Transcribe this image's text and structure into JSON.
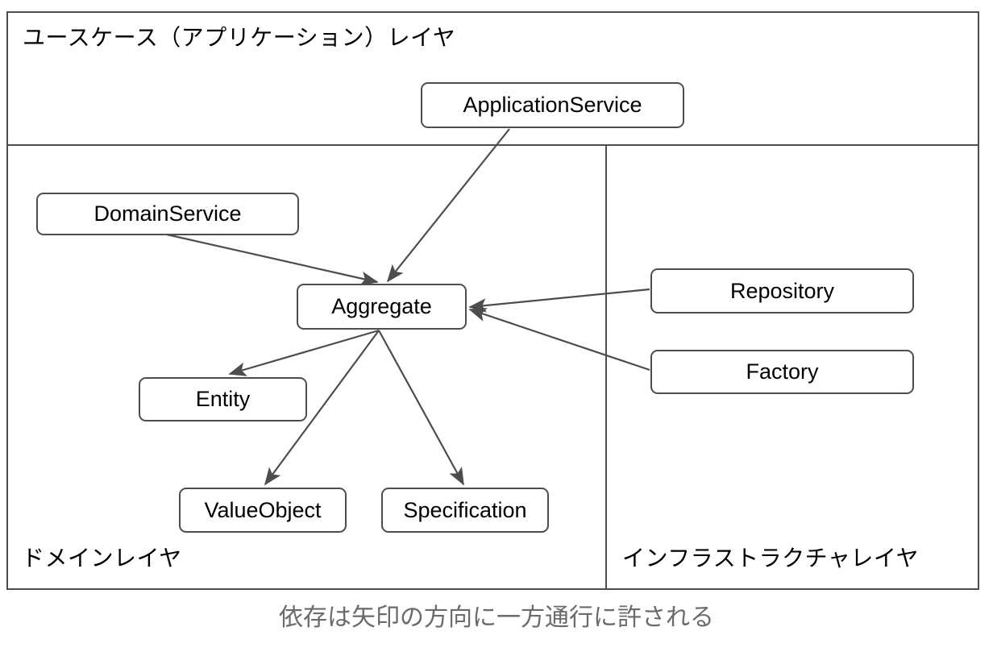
{
  "diagram": {
    "title_usecase_layer": "ユースケース（アプリケーション）レイヤ",
    "title_domain_layer": "ドメインレイヤ",
    "title_infrastructure_layer": "インフラストラクチャレイヤ",
    "caption": "依存は矢印の方向に一方通行に許される",
    "colors": {
      "stroke": "#4d4d4d",
      "node_fill": "#ffffff",
      "text": "#000000",
      "caption_text": "#6b6b6b",
      "background": "#ffffff"
    },
    "nodes": [
      {
        "id": "applicationservice",
        "label": "ApplicationService",
        "layer": "usecase"
      },
      {
        "id": "domainservice",
        "label": "DomainService",
        "layer": "domain"
      },
      {
        "id": "aggregate",
        "label": "Aggregate",
        "layer": "domain"
      },
      {
        "id": "entity",
        "label": "Entity",
        "layer": "domain"
      },
      {
        "id": "valueobject",
        "label": "ValueObject",
        "layer": "domain"
      },
      {
        "id": "specification",
        "label": "Specification",
        "layer": "domain"
      },
      {
        "id": "repository",
        "label": "Repository",
        "layer": "infrastructure"
      },
      {
        "id": "factory",
        "label": "Factory",
        "layer": "infrastructure"
      }
    ],
    "edges": [
      {
        "id": "applicationservice-to-aggregate",
        "from": "applicationservice",
        "to": "aggregate"
      },
      {
        "id": "domainservice-to-aggregate",
        "from": "domainservice",
        "to": "aggregate"
      },
      {
        "id": "repository-to-aggregate",
        "from": "repository",
        "to": "aggregate"
      },
      {
        "id": "factory-to-aggregate",
        "from": "factory",
        "to": "aggregate"
      },
      {
        "id": "aggregate-to-entity",
        "from": "aggregate",
        "to": "entity"
      },
      {
        "id": "aggregate-to-valueobject",
        "from": "aggregate",
        "to": "valueobject"
      },
      {
        "id": "aggregate-to-specification",
        "from": "aggregate",
        "to": "specification"
      }
    ]
  }
}
